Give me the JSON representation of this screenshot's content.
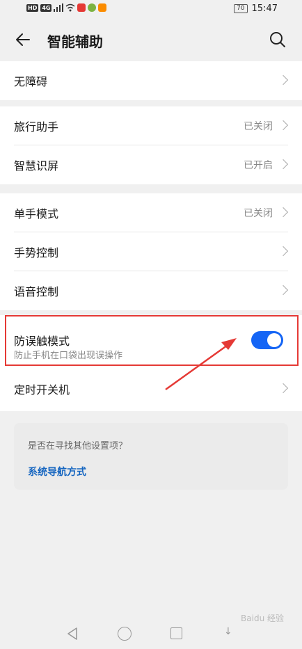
{
  "status_bar": {
    "left_chips": [
      "HD",
      "4G"
    ],
    "battery": "70",
    "time": "15:47"
  },
  "header": {
    "title": "智能辅助"
  },
  "groups": [
    {
      "rows": [
        {
          "label": "无障碍",
          "status": ""
        }
      ]
    },
    {
      "rows": [
        {
          "label": "旅行助手",
          "status": "已关闭"
        },
        {
          "label": "智慧识屏",
          "status": "已开启"
        }
      ]
    },
    {
      "rows": [
        {
          "label": "单手模式",
          "status": "已关闭"
        },
        {
          "label": "手势控制",
          "status": ""
        },
        {
          "label": "语音控制",
          "status": ""
        }
      ]
    }
  ],
  "toggle_item": {
    "label": "防误触模式",
    "subtitle": "防止手机在口袋出现误操作",
    "enabled": true
  },
  "timer_item": {
    "label": "定时开关机"
  },
  "suggestion": {
    "question": "是否在寻找其他设置项？",
    "link": "系统导航方式"
  },
  "colors": {
    "accent": "#1565f5",
    "highlight_border": "#e53935",
    "link": "#1565c0"
  },
  "watermark": "Baidu 经验"
}
